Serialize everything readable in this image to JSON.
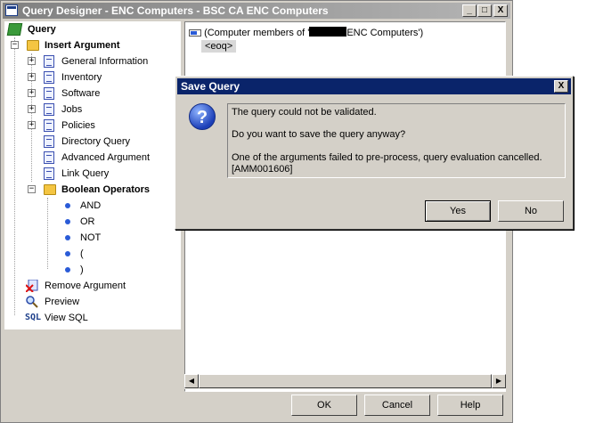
{
  "window": {
    "title": "Query Designer - ENC Computers - BSC CA ENC Computers",
    "minimize": "_",
    "maximize": "□",
    "close": "X"
  },
  "tree": {
    "root": "Query",
    "insert_argument": "Insert Argument",
    "insert_children": [
      "General Information",
      "Inventory",
      "Software",
      "Jobs",
      "Policies",
      "Directory Query",
      "Advanced Argument",
      "Link Query"
    ],
    "boolean_operators": "Boolean Operators",
    "operators": [
      "AND",
      "OR",
      "NOT",
      "(",
      ")"
    ],
    "remove_argument": "Remove Argument",
    "preview": "Preview",
    "view_sql": "View SQL",
    "sql_icon_text": "SQL"
  },
  "editor": {
    "line1_prefix": "(Computer members of '",
    "line1_suffix": "ENC Computers')",
    "eoq": "<eoq>"
  },
  "buttons": {
    "ok": "OK",
    "cancel": "Cancel",
    "help": "Help"
  },
  "dialog": {
    "title": "Save Query",
    "close": "X",
    "icon_glyph": "?",
    "line1": "The query could not be validated.",
    "line2": "Do you want to save the query anyway?",
    "line3": "One of the arguments failed to pre-process, query evaluation cancelled.",
    "line4": "[AMM001606]",
    "yes": "Yes",
    "no": "No"
  },
  "colors": {
    "dialog_title": "#0a246a",
    "window_title": "#808080",
    "face": "#d4d0c8"
  }
}
